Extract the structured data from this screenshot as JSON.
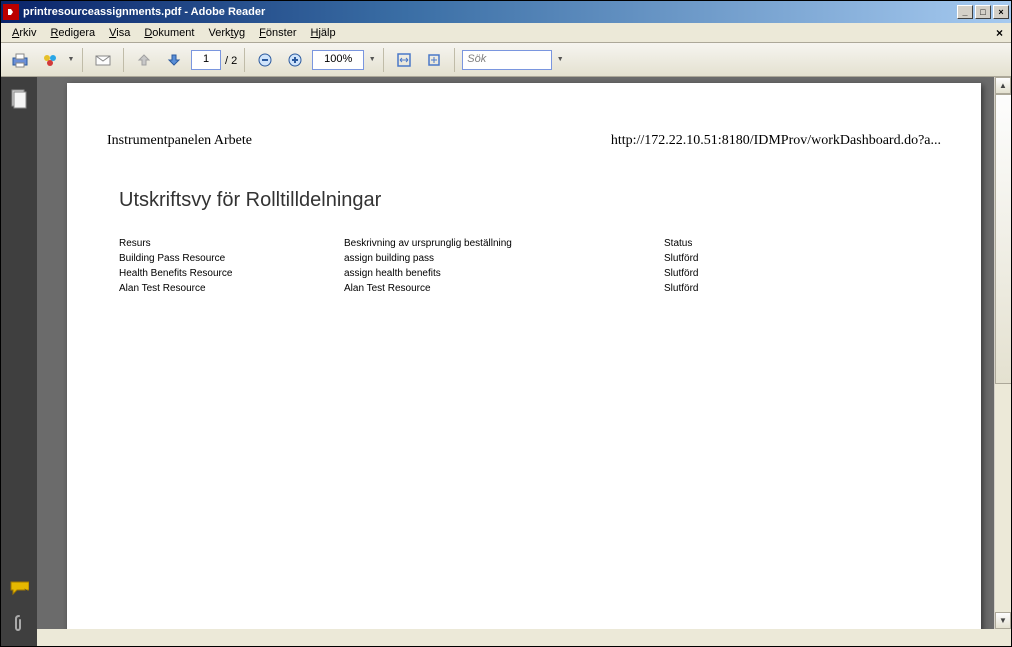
{
  "window": {
    "title": "printresourceassignments.pdf - Adobe Reader"
  },
  "menubar": {
    "items": [
      {
        "label": "Arkiv",
        "u": "A"
      },
      {
        "label": "Redigera",
        "u": "R"
      },
      {
        "label": "Visa",
        "u": "V"
      },
      {
        "label": "Dokument",
        "u": "D"
      },
      {
        "label": "Verktyg",
        "u": "V"
      },
      {
        "label": "Fönster",
        "u": "F"
      },
      {
        "label": "Hjälp",
        "u": "H"
      }
    ]
  },
  "toolbar": {
    "current_page": "1",
    "page_total": "/ 2",
    "zoom": "100%",
    "search_placeholder": "Sök"
  },
  "document": {
    "header_left": "Instrumentpanelen Arbete",
    "header_right": "http://172.22.10.51:8180/IDMProv/workDashboard.do?a...",
    "title": "Utskriftsvy för Rolltilldelningar",
    "columns": [
      "Resurs",
      "Beskrivning av ursprunglig beställning",
      "Status"
    ],
    "rows": [
      {
        "c1": "Building Pass Resource",
        "c2": "assign building pass",
        "c3": "Slutförd"
      },
      {
        "c1": "Health Benefits Resource",
        "c2": "assign health benefits",
        "c3": "Slutförd"
      },
      {
        "c1": "Alan Test Resource",
        "c2": "Alan Test Resource",
        "c3": "Slutförd"
      }
    ]
  }
}
